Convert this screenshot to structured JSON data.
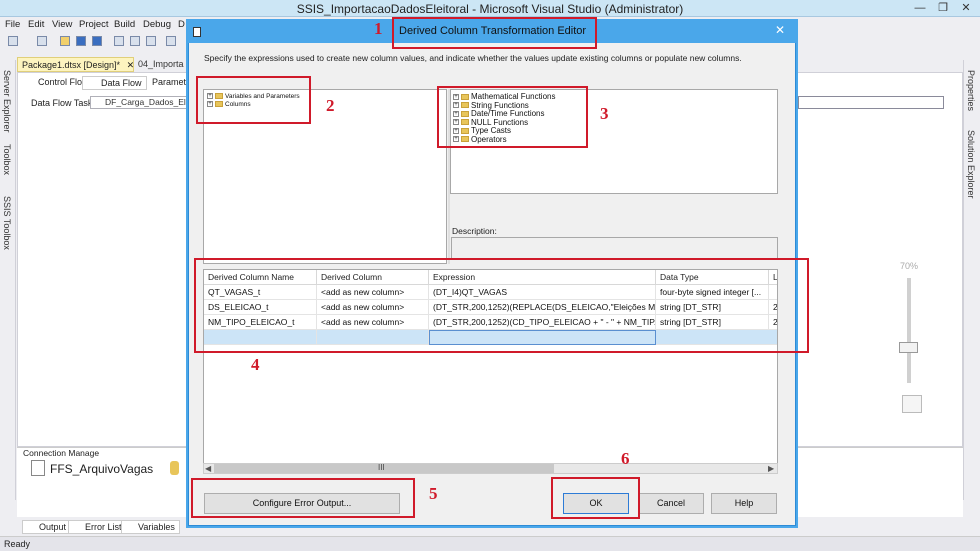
{
  "window": {
    "title": "SSIS_ImportacaoDadosEleitoral - Microsoft Visual Studio (Administrator)",
    "min": "—",
    "max": "❐",
    "close": "✕"
  },
  "menu": [
    "File",
    "Edit",
    "View",
    "Project",
    "Build",
    "Debug",
    "D"
  ],
  "left_strip": [
    "Server Explorer",
    "Toolbox",
    "SSIS Toolbox"
  ],
  "right_strip": [
    "Properties",
    "Solution Explorer"
  ],
  "doc_tabs": {
    "active": "Package1.dtsx [Design]*",
    "close": "✕",
    "second": "04_Importa"
  },
  "designer": {
    "subtabs": [
      "Control Flow",
      "Data Flow",
      "Parameter"
    ],
    "task_label": "Data Flow Task:",
    "task_value": "DF_Carga_Dados_Eleit",
    "zoom": "70%"
  },
  "connection": {
    "header": "Connection Manage",
    "item": "FFS_ArquivoVagas"
  },
  "bottom_tabs": [
    "Output",
    "Error List",
    "Variables"
  ],
  "status": "Ready",
  "dialog": {
    "title": "Derived Column Transformation Editor",
    "description": "Specify the expressions used to create new column values, and indicate whether the values update existing columns or populate new columns.",
    "left_tree": [
      "Variables and Parameters",
      "Columns"
    ],
    "right_tree": [
      "Mathematical Functions",
      "String Functions",
      "Date/Time Functions",
      "NULL Functions",
      "Type Casts",
      "Operators"
    ],
    "desc_label": "Description:",
    "grid": {
      "headers": [
        "Derived Column Name",
        "Derived Column",
        "Expression",
        "Data Type",
        "Le"
      ],
      "rows": [
        [
          "QT_VAGAS_t",
          "<add as new column>",
          "(DT_I4)QT_VAGAS",
          "four-byte signed integer [...",
          ""
        ],
        [
          "DS_ELEICAO_t",
          "<add as new column>",
          "(DT_STR,200,1252)(REPLACE(DS_ELEICAO,\"Eleições Mun...",
          "string [DT_STR]",
          "2("
        ],
        [
          "NM_TIPO_ELEICAO_t",
          "<add as new column>",
          "(DT_STR,200,1252)(CD_TIPO_ELEICAO + \" - \" + NM_TIP...",
          "string [DT_STR]",
          "2("
        ]
      ]
    },
    "scroll_glyph": "III",
    "buttons": {
      "config_error": "Configure Error Output...",
      "ok": "OK",
      "cancel": "Cancel",
      "help": "Help"
    }
  },
  "annotations": [
    "1",
    "2",
    "3",
    "4",
    "5",
    "6"
  ],
  "colors": {
    "annotation": "#d01a2a",
    "dialog_title": "#4aa7ea",
    "active_tab": "#fdf4bf"
  }
}
